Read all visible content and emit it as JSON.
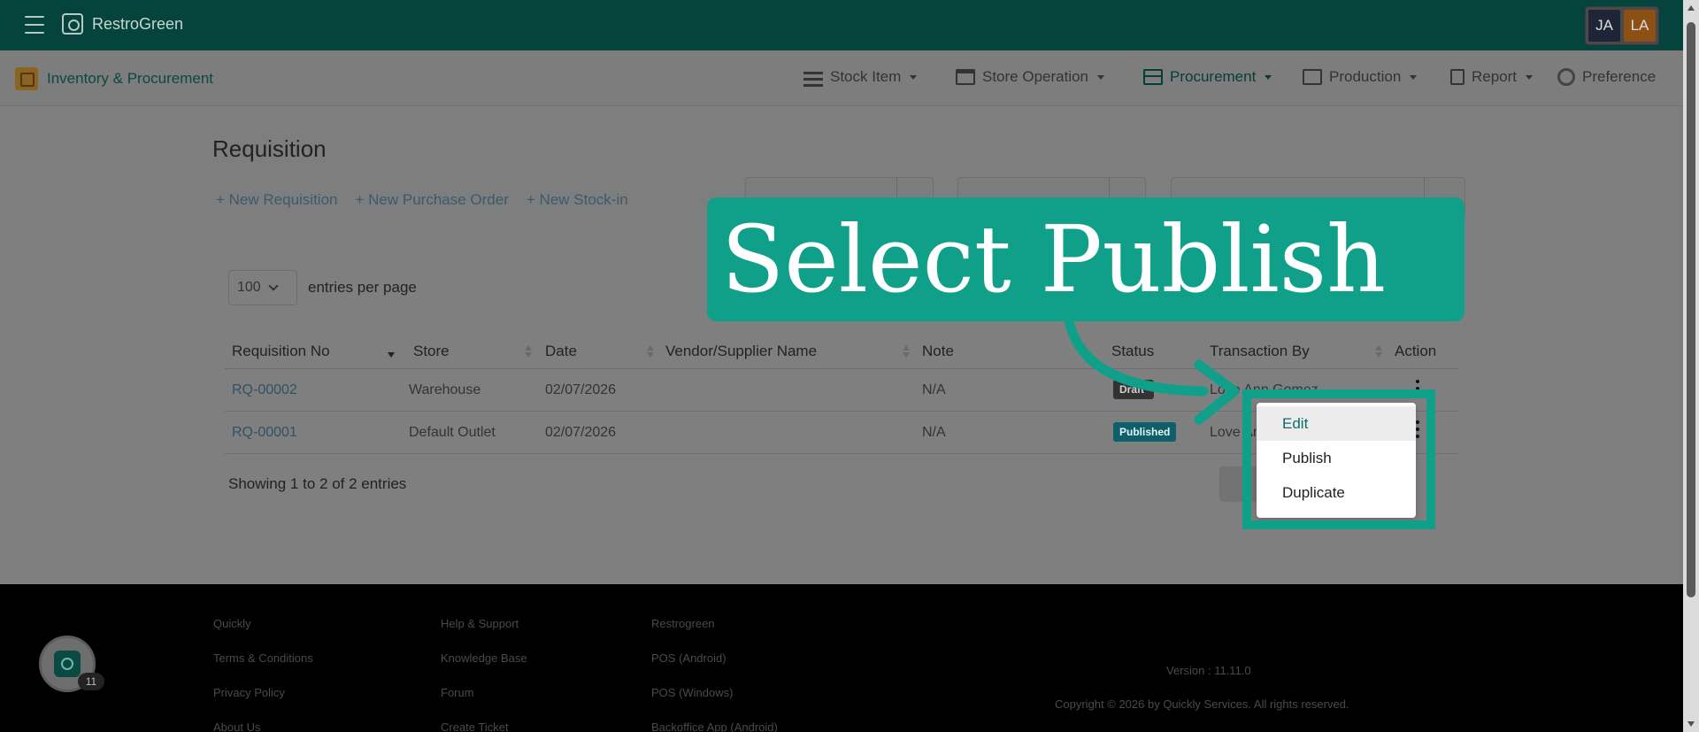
{
  "app": {
    "brand": "RestroGreen",
    "users": [
      "JA",
      "LA"
    ]
  },
  "module": {
    "title": "Inventory & Procurement",
    "nav": [
      {
        "label": "Stock Item",
        "icon": "list-icon",
        "active": false
      },
      {
        "label": "Store Operation",
        "icon": "store-icon",
        "active": false
      },
      {
        "label": "Procurement",
        "icon": "procurement-icon",
        "active": true
      },
      {
        "label": "Production",
        "icon": "production-icon",
        "active": false
      },
      {
        "label": "Report",
        "icon": "clipboard-icon",
        "active": false
      },
      {
        "label": "Preference",
        "icon": "gear-icon",
        "active": false
      }
    ]
  },
  "page": {
    "title": "Requisition",
    "actions": [
      "+ New Requisition",
      "+ New Purchase Order",
      "+ New Stock-in"
    ]
  },
  "table": {
    "entries_value": "100",
    "entries_label": "entries per page",
    "columns": [
      "Requisition No",
      "Store",
      "Date",
      "Vendor/Supplier Name",
      "Note",
      "Status",
      "Transaction By",
      "Action"
    ],
    "rows": [
      {
        "no": "RQ-00002",
        "store": "Warehouse",
        "date": "02/07/2026",
        "vendor": "",
        "note": "N/A",
        "status": "Draft",
        "by": "Love Ann Gomez"
      },
      {
        "no": "RQ-00001",
        "store": "Default Outlet",
        "date": "02/07/2026",
        "vendor": "",
        "note": "N/A",
        "status": "Published",
        "by": "Love Ann Gomez"
      }
    ],
    "showing": "Showing 1 to 2 of 2 entries"
  },
  "dropdown": {
    "items": [
      "Edit",
      "Publish",
      "Duplicate"
    ]
  },
  "callout": {
    "text": "Select Publish"
  },
  "footer": {
    "col1": [
      "Quickly",
      "Terms & Conditions",
      "Privacy Policy",
      "About Us"
    ],
    "col2": [
      "Help & Support",
      "Knowledge Base",
      "Forum",
      "Create Ticket"
    ],
    "col3": [
      "Restrogreen",
      "POS (Android)",
      "POS (Windows)",
      "Backoffice App (Android)"
    ],
    "version": "Version : 11.11.0",
    "copyright": "Copyright © 2026 by Quickly Services. All rights reserved.",
    "chat_count": "11"
  },
  "colors": {
    "topbar": "#04443c",
    "accent": "#10a08a",
    "link": "#2f5266"
  }
}
